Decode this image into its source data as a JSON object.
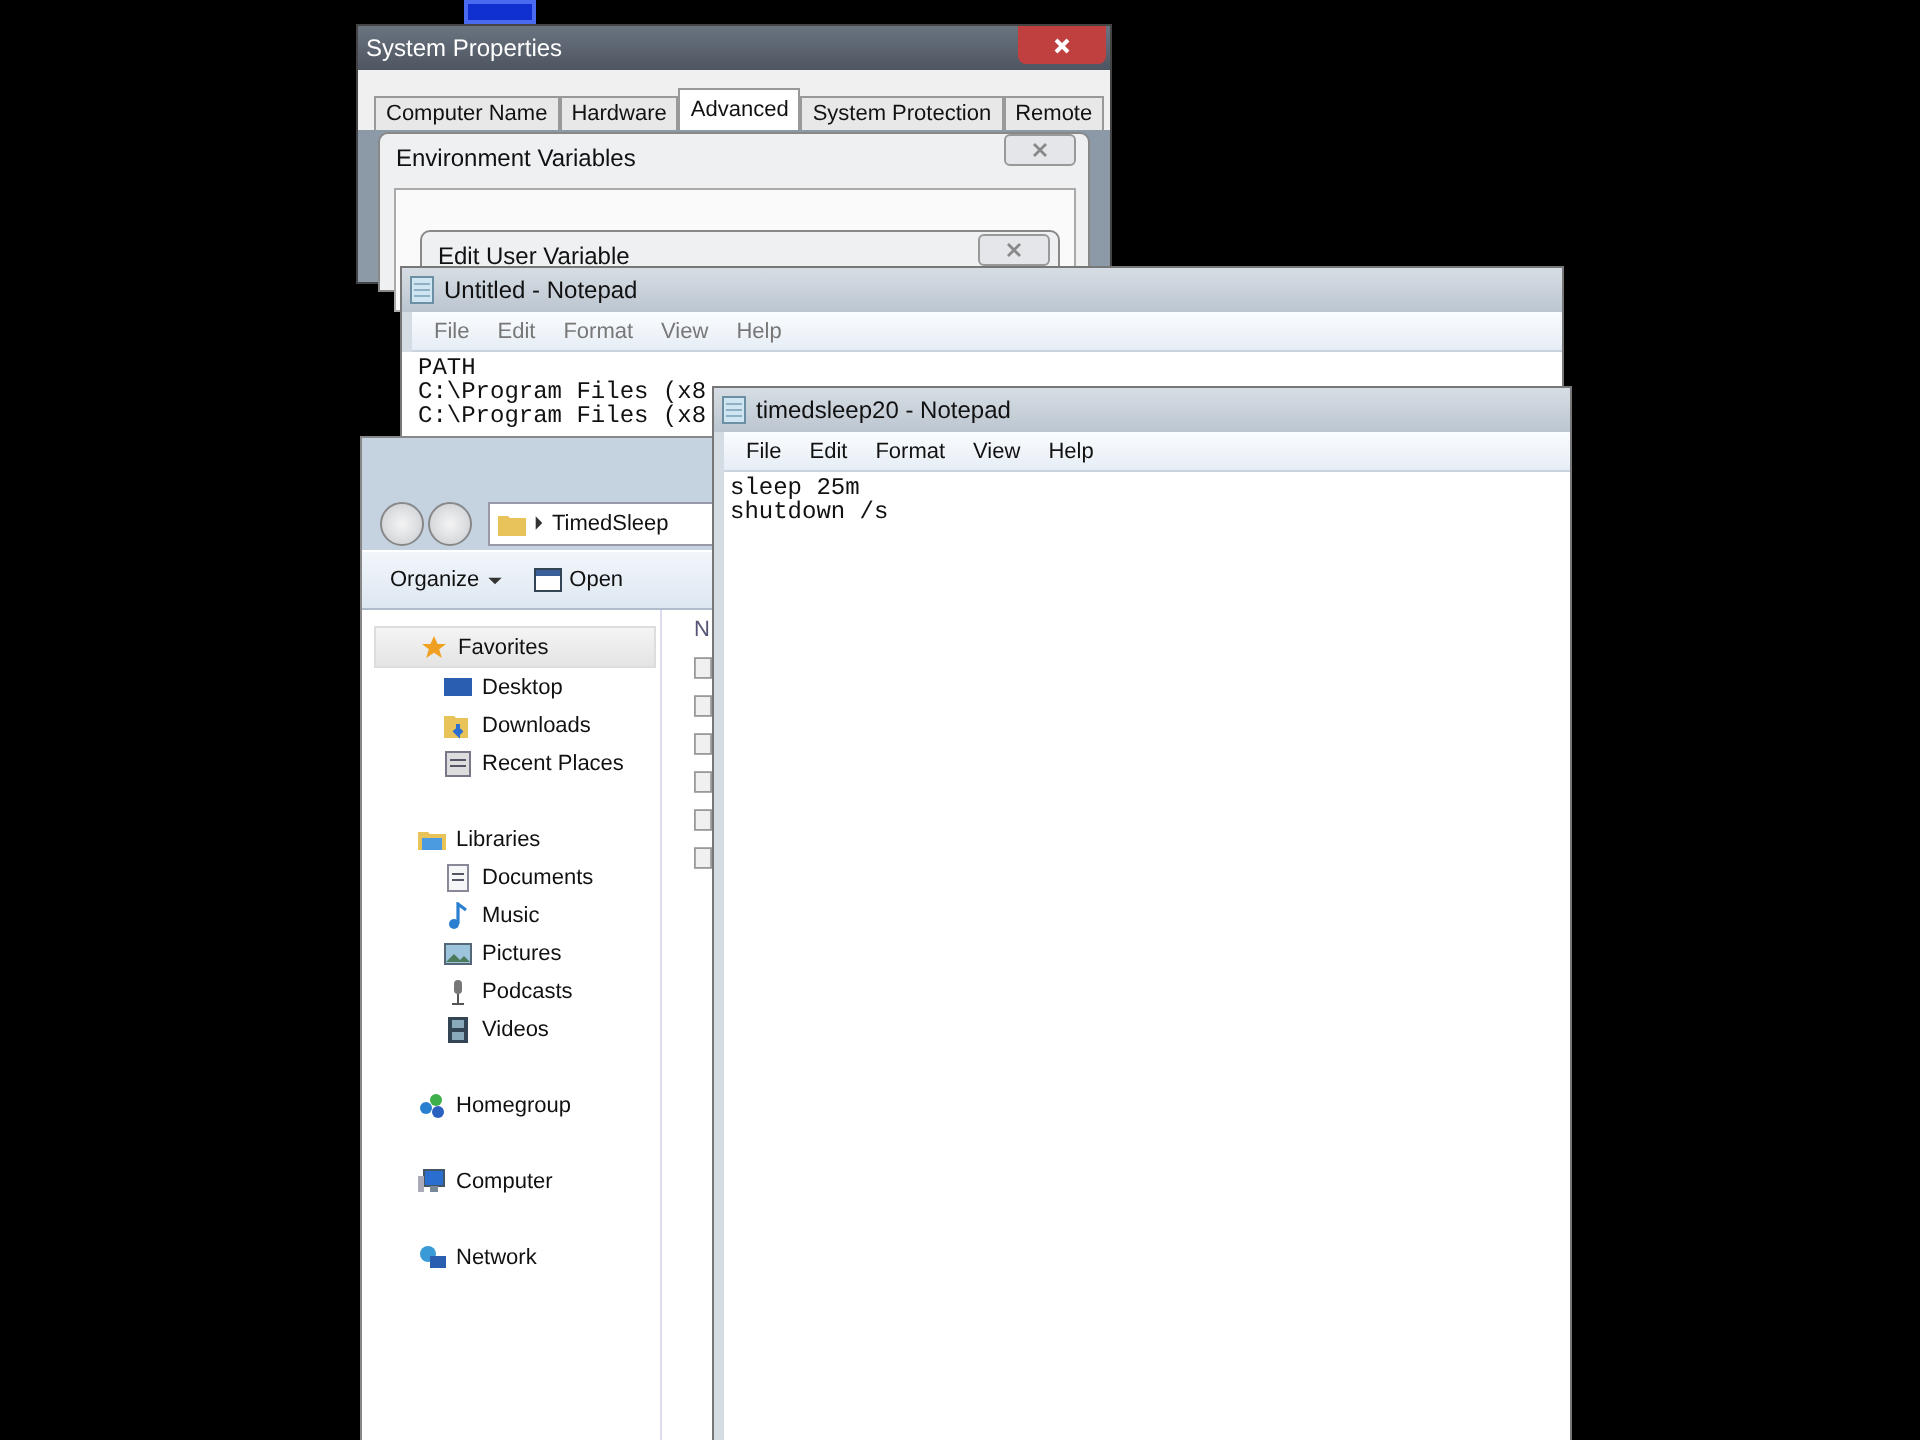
{
  "system_properties": {
    "title": "System Properties",
    "tabs": [
      {
        "label": "Computer Name",
        "selected": false
      },
      {
        "label": "Hardware",
        "selected": false
      },
      {
        "label": "Advanced",
        "selected": true
      },
      {
        "label": "System Protection",
        "selected": false
      },
      {
        "label": "Remote",
        "selected": false
      }
    ]
  },
  "environment_dialog": {
    "title": "Environment Variables"
  },
  "edit_dialog": {
    "title": "Edit User Variable"
  },
  "notepad_back": {
    "title": "Untitled - Notepad",
    "menu": [
      "File",
      "Edit",
      "Format",
      "View",
      "Help"
    ],
    "lines": [
      "PATH",
      "C:\\Program Files (x8",
      "C:\\Program Files (x8"
    ]
  },
  "explorer": {
    "breadcrumb": "TimedSleep",
    "toolbar": [
      {
        "label": "Organize",
        "kind": "menu"
      },
      {
        "label": "Open",
        "kind": "action"
      }
    ],
    "column_1": "N",
    "nav": [
      {
        "label": "Favorites",
        "selected": true,
        "children": [
          {
            "label": "Desktop",
            "selected": false
          },
          {
            "label": "Downloads",
            "selected": false
          },
          {
            "label": "Recent Places",
            "selected": false
          }
        ]
      },
      {
        "label": "Libraries",
        "selected": false,
        "children": [
          {
            "label": "Documents",
            "selected": false
          },
          {
            "label": "Music",
            "selected": false
          },
          {
            "label": "Pictures",
            "selected": false
          },
          {
            "label": "Podcasts",
            "selected": false
          },
          {
            "label": "Videos",
            "selected": false
          }
        ]
      },
      {
        "label": "Homegroup",
        "selected": false
      },
      {
        "label": "Computer",
        "selected": false
      },
      {
        "label": "Network",
        "selected": false
      }
    ]
  },
  "notepad_front": {
    "title": "timedsleep20 - Notepad",
    "menu": [
      "File",
      "Edit",
      "Format",
      "View",
      "Help"
    ],
    "lines": [
      "sleep 25m",
      "shutdown /s"
    ]
  }
}
